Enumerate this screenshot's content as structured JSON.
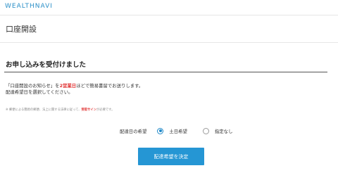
{
  "header": {
    "logo_text": "WEALTHNAVI"
  },
  "page": {
    "title": "口座開設"
  },
  "section": {
    "title": "お申し込みを受付けました"
  },
  "notice": {
    "line1_a": "「口座開設のお知らせ」を",
    "line1_b": "2営業日",
    "line1_c": "ほどで簡易書留でお送りします。",
    "line2": "配達希望日を選択してください。"
  },
  "footnote": {
    "part_a": "※ 郵便による簡易の郵便、法上に関する法律に従って、",
    "part_b": "受取サイン",
    "part_c": "が必要です。"
  },
  "delivery": {
    "label": "配達日の希望",
    "options": [
      {
        "label": "土日希望",
        "checked": true
      },
      {
        "label": "指定なし",
        "checked": false
      }
    ]
  },
  "submit": {
    "label": "配達希望を決定"
  },
  "colors": {
    "accent": "#2596d4",
    "emphasis": "#e03131",
    "logo": "#2a8fc7"
  }
}
